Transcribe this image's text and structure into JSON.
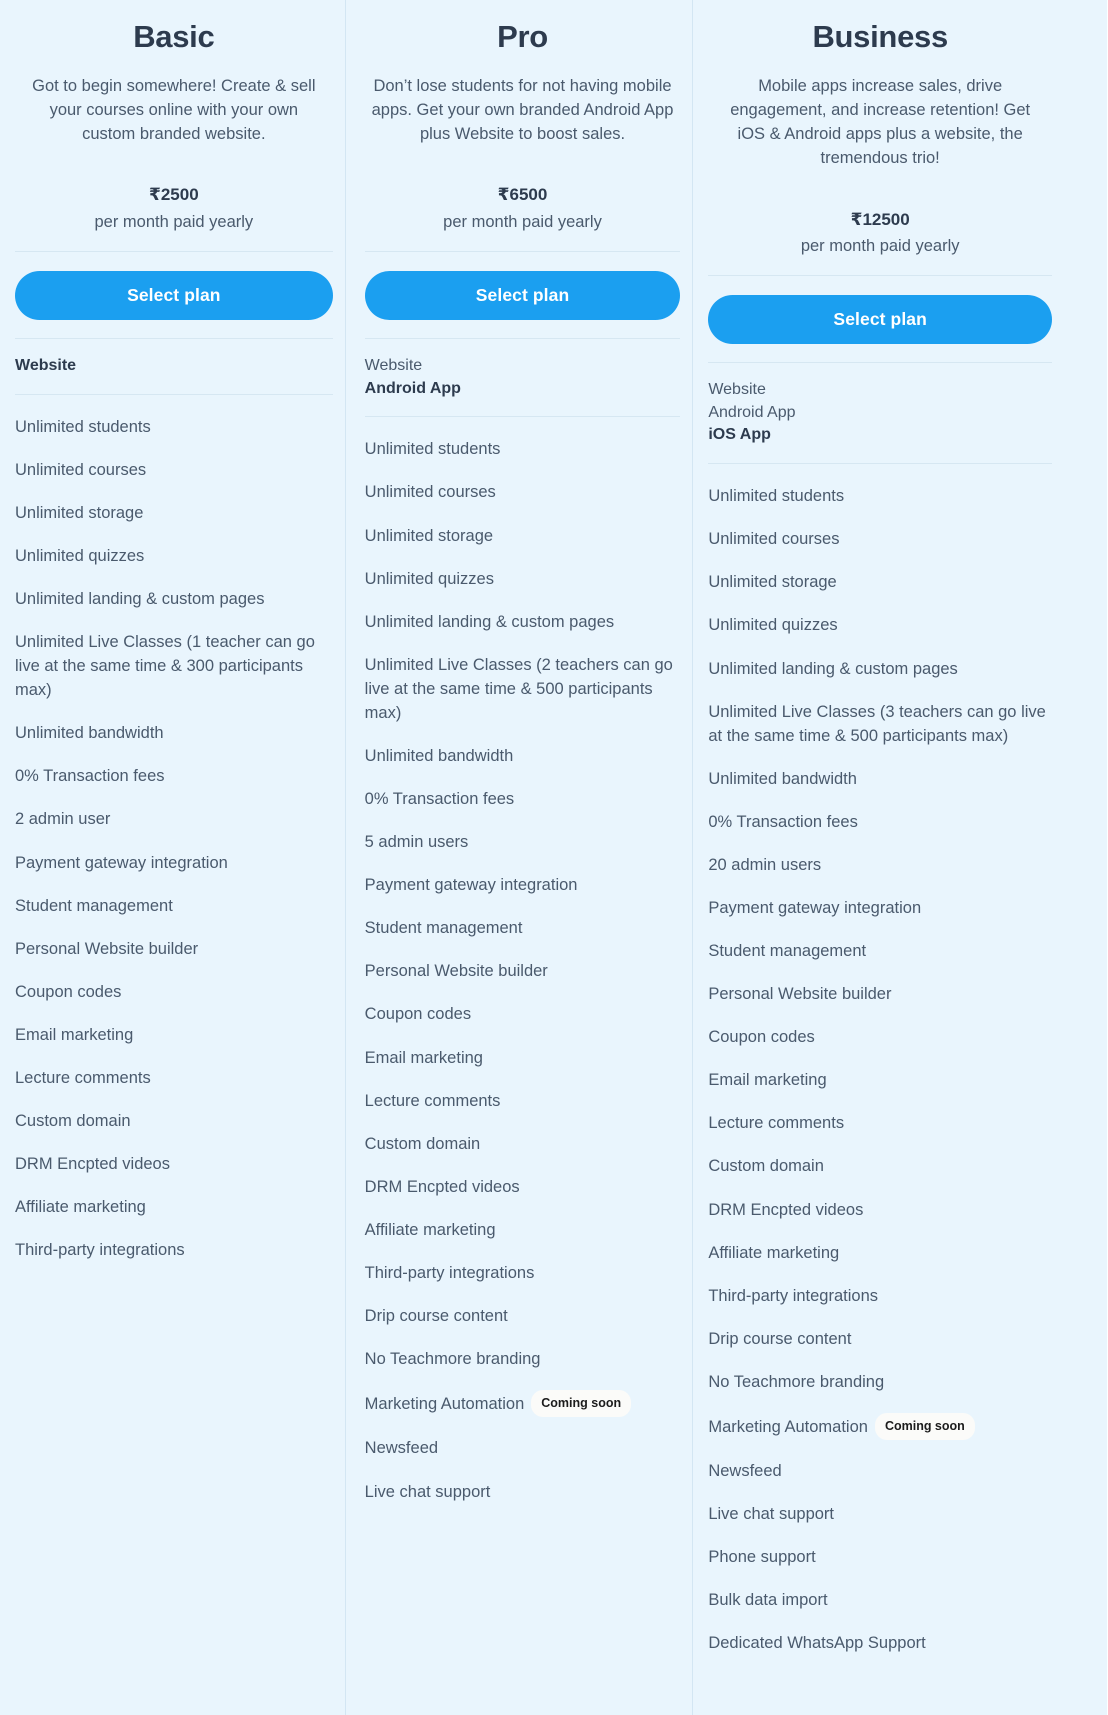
{
  "ui": {
    "accent_color": "#1b9ff0",
    "column_bg": "#e9f5fd",
    "heading_color": "#2d3b4e",
    "body_color": "#4a5a6d",
    "divider_color": "#d6e7f2",
    "badge_bg": "#fbfbf9"
  },
  "plans": [
    {
      "id": "basic",
      "title": "Basic",
      "description": "Got to begin somewhere! Create & sell your courses online with your own custom branded website.",
      "price": "₹2500",
      "price_period": "per month paid yearly",
      "cta_label": "Select plan",
      "platforms": [
        {
          "label": "Website",
          "highlighted": true
        }
      ],
      "features": [
        {
          "label": "Unlimited students"
        },
        {
          "label": "Unlimited courses"
        },
        {
          "label": "Unlimited storage"
        },
        {
          "label": "Unlimited quizzes"
        },
        {
          "label": "Unlimited landing & custom pages"
        },
        {
          "label": "Unlimited Live Classes (1 teacher can go live at the same time & 300 participants max)"
        },
        {
          "label": "Unlimited bandwidth"
        },
        {
          "label": "0% Transaction fees"
        },
        {
          "label": "2 admin user"
        },
        {
          "label": "Payment gateway integration"
        },
        {
          "label": "Student management"
        },
        {
          "label": "Personal Website builder"
        },
        {
          "label": "Coupon codes"
        },
        {
          "label": "Email marketing"
        },
        {
          "label": "Lecture comments"
        },
        {
          "label": "Custom domain"
        },
        {
          "label": "DRM Encpted videos"
        },
        {
          "label": "Affiliate marketing"
        },
        {
          "label": "Third-party integrations"
        }
      ]
    },
    {
      "id": "pro",
      "title": "Pro",
      "description": "Don’t lose students for not having mobile apps. Get your own branded Android App plus Website to boost sales.",
      "price": "₹6500",
      "price_period": "per month paid yearly",
      "cta_label": "Select plan",
      "platforms": [
        {
          "label": "Website",
          "highlighted": false
        },
        {
          "label": "Android App",
          "highlighted": true
        }
      ],
      "features": [
        {
          "label": "Unlimited students"
        },
        {
          "label": "Unlimited courses"
        },
        {
          "label": "Unlimited storage"
        },
        {
          "label": "Unlimited quizzes"
        },
        {
          "label": "Unlimited landing & custom pages"
        },
        {
          "label": "Unlimited Live Classes (2 teachers can go live at the same time & 500 participants max)"
        },
        {
          "label": "Unlimited bandwidth"
        },
        {
          "label": "0% Transaction fees"
        },
        {
          "label": "5 admin users"
        },
        {
          "label": "Payment gateway integration"
        },
        {
          "label": "Student management"
        },
        {
          "label": "Personal Website builder"
        },
        {
          "label": "Coupon codes"
        },
        {
          "label": "Email marketing"
        },
        {
          "label": "Lecture comments"
        },
        {
          "label": "Custom domain"
        },
        {
          "label": "DRM Encpted videos"
        },
        {
          "label": "Affiliate marketing"
        },
        {
          "label": "Third-party integrations"
        },
        {
          "label": "Drip course content"
        },
        {
          "label": "No Teachmore branding"
        },
        {
          "label": "Marketing Automation",
          "badge": "Coming soon"
        },
        {
          "label": "Newsfeed"
        },
        {
          "label": "Live chat support"
        }
      ]
    },
    {
      "id": "business",
      "title": "Business",
      "description": "Mobile apps increase sales, drive engagement, and increase retention! Get iOS & Android apps plus a website, the tremendous trio!",
      "price": "₹12500",
      "price_period": "per month paid yearly",
      "cta_label": "Select plan",
      "platforms": [
        {
          "label": "Website",
          "highlighted": false
        },
        {
          "label": "Android App",
          "highlighted": false
        },
        {
          "label": "iOS App",
          "highlighted": true
        }
      ],
      "features": [
        {
          "label": "Unlimited students"
        },
        {
          "label": "Unlimited courses"
        },
        {
          "label": "Unlimited storage"
        },
        {
          "label": "Unlimited quizzes"
        },
        {
          "label": "Unlimited landing & custom pages"
        },
        {
          "label": "Unlimited Live Classes (3 teachers can go live at the same time & 500 participants max)"
        },
        {
          "label": "Unlimited bandwidth"
        },
        {
          "label": "0% Transaction fees"
        },
        {
          "label": "20 admin users"
        },
        {
          "label": "Payment gateway integration"
        },
        {
          "label": "Student management"
        },
        {
          "label": "Personal Website builder"
        },
        {
          "label": "Coupon codes"
        },
        {
          "label": "Email marketing"
        },
        {
          "label": "Lecture comments"
        },
        {
          "label": "Custom domain"
        },
        {
          "label": "DRM Encpted videos"
        },
        {
          "label": "Affiliate marketing"
        },
        {
          "label": "Third-party integrations"
        },
        {
          "label": "Drip course content"
        },
        {
          "label": "No Teachmore branding"
        },
        {
          "label": "Marketing Automation",
          "badge": "Coming soon"
        },
        {
          "label": "Newsfeed"
        },
        {
          "label": "Live chat support"
        },
        {
          "label": "Phone support"
        },
        {
          "label": "Bulk data import"
        },
        {
          "label": "Dedicated WhatsApp Support"
        }
      ]
    }
  ]
}
